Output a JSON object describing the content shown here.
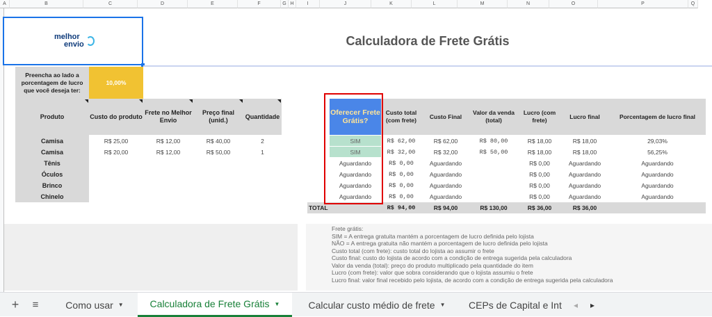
{
  "columns": [
    "A",
    "B",
    "C",
    "D",
    "E",
    "F",
    "G",
    "H",
    "I",
    "J",
    "K",
    "L",
    "M",
    "N",
    "O",
    "P",
    "Q"
  ],
  "logo": {
    "line1": "melhor",
    "line2": "envio"
  },
  "title": "Calculadora de Frete Grátis",
  "input": {
    "label": "Preencha ao lado a porcentagem de lucro que você deseja ter:",
    "value": "10,00%"
  },
  "left_table": {
    "headers": [
      "Produto",
      "Custo do produto",
      "Frete no Melhor Envio",
      "Preço final (unid.)",
      "Quantidade"
    ],
    "rows": [
      [
        "Camisa",
        "R$ 25,00",
        "R$ 12,00",
        "R$ 40,00",
        "2"
      ],
      [
        "Camisa",
        "R$ 20,00",
        "R$ 12,00",
        "R$ 50,00",
        "1"
      ],
      [
        "Tênis",
        "",
        "",
        "",
        ""
      ],
      [
        "Óculos",
        "",
        "",
        "",
        ""
      ],
      [
        "Brinco",
        "",
        "",
        "",
        ""
      ],
      [
        "Chinelo",
        "",
        "",
        "",
        ""
      ]
    ]
  },
  "right_table": {
    "headers": [
      "Oferecer Frete Grátis?",
      "Custo total (com frete)",
      "Custo Final",
      "Valor da venda (total)",
      "Lucro (com frete)",
      "Lucro final",
      "Porcentagem de lucro final"
    ],
    "rows": [
      [
        "SIM",
        "R$ 62,00",
        "R$ 62,00",
        "R$ 80,00",
        "R$ 18,00",
        "R$ 18,00",
        "29,03%"
      ],
      [
        "SIM",
        "R$ 32,00",
        "R$ 32,00",
        "R$ 50,00",
        "R$ 18,00",
        "R$ 18,00",
        "56,25%"
      ],
      [
        "Aguardando",
        "R$ 0,00",
        "Aguardando",
        "",
        "R$ 0,00",
        "Aguardando",
        "Aguardando"
      ],
      [
        "Aguardando",
        "R$ 0,00",
        "Aguardando",
        "",
        "R$ 0,00",
        "Aguardando",
        "Aguardando"
      ],
      [
        "Aguardando",
        "R$ 0,00",
        "Aguardando",
        "",
        "R$ 0,00",
        "Aguardando",
        "Aguardando"
      ],
      [
        "Aguardando",
        "R$ 0,00",
        "Aguardando",
        "",
        "R$ 0,00",
        "Aguardando",
        "Aguardando"
      ]
    ],
    "total": {
      "label": "TOTAL",
      "custo_total": "R$ 94,00",
      "custo_final": "R$ 94,00",
      "valor_venda": "R$ 130,00",
      "lucro": "R$ 36,00",
      "lucro_final": "R$ 36,00"
    }
  },
  "legend": [
    "Frete grátis:",
    "SIM = A entrega gratuita mantém a porcentagem de lucro definida pelo lojista",
    "NÃO = A entrega gratuita não mantém a porcentagem de lucro definida pelo lojista",
    "Custo total (com frete): custo total do lojista ao assumir o frete",
    "Custo final: custo do lojista de acordo com a condição de entrega sugerida pela calculadora",
    "Valor da venda (total): preço do produto multiplicado pela quantidade do item",
    "Lucro (com frete): valor que sobra considerando que o lojista assumiu o frete",
    "Lucro final: valor final recebido pelo lojista, de acordo com a condição de entrega sugerida pela calculadora"
  ],
  "tabs": {
    "add_icon": "+",
    "menu_icon": "≡",
    "items": [
      {
        "label": "Como usar",
        "active": false
      },
      {
        "label": "Calculadora de Frete Grátis",
        "active": true
      },
      {
        "label": "Calcular custo médio de frete",
        "active": false
      },
      {
        "label": "CEPs de Capital e Int",
        "active": false
      }
    ],
    "prev_icon": "◂",
    "next_icon": "▸"
  },
  "colors": {
    "accent": "#188038",
    "highlight_blue": "#4a86e8",
    "highlight_yellow": "#f1c232",
    "sim_green": "#b7e1cd",
    "red_border": "#e00000"
  }
}
